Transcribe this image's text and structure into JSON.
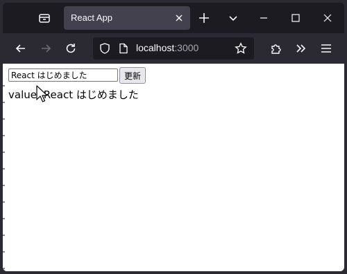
{
  "browser": {
    "tab": {
      "title": "React App"
    },
    "url": {
      "host": "localhost",
      "port": ":3000"
    }
  },
  "page": {
    "input_value": "React はじめました",
    "button_label": "更新",
    "value_label": "value: ",
    "value_text": "React はじめました"
  },
  "icons": {
    "tab_list": "tab-list-icon",
    "close_tab": "close-icon",
    "new_tab": "plus-icon",
    "list_all_tabs": "chevron-down-icon",
    "minimize": "minimize-icon",
    "maximize": "maximize-icon",
    "close_window": "close-icon",
    "back": "arrow-left-icon",
    "forward": "arrow-right-icon",
    "reload": "reload-icon",
    "tracking_protection": "shield-icon",
    "page_info": "page-icon",
    "bookmark": "star-icon",
    "extensions": "puzzle-icon",
    "overflow": "double-chevron-icon",
    "menu": "hamburger-icon",
    "cursor": "mouse-cursor-icon"
  }
}
